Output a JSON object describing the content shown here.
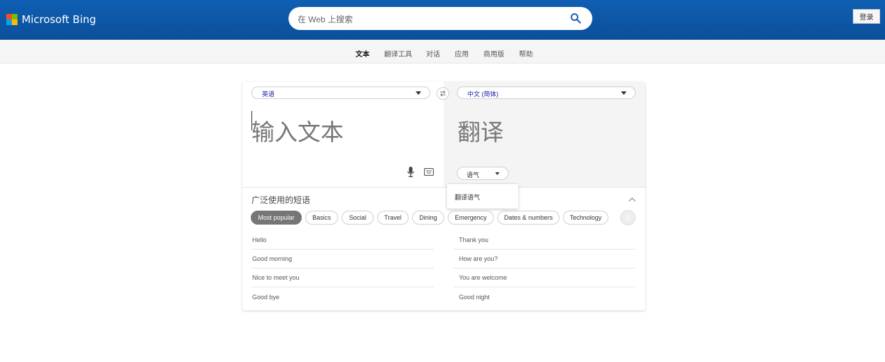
{
  "header": {
    "brand": "Microsoft Bing",
    "logo_colors": [
      "#f25022",
      "#7fba00",
      "#00a4ef",
      "#ffb900"
    ],
    "search_placeholder": "在 Web 上搜索",
    "login_label": "登录"
  },
  "nav": {
    "items": [
      "文本",
      "翻译工具",
      "对话",
      "应用",
      "商用版",
      "帮助"
    ],
    "active": "文本"
  },
  "translator": {
    "source_lang": "英语",
    "target_lang": "中文 (简体)",
    "source_placeholder": "输入文本",
    "target_placeholder": "翻译",
    "tone_label": "语气",
    "tone_dropdown_option": "翻译语气"
  },
  "phrases": {
    "title": "广泛使用的短语",
    "categories": [
      "Most popular",
      "Basics",
      "Social",
      "Travel",
      "Dining",
      "Emergency",
      "Dates & numbers",
      "Technology"
    ],
    "active_category": "Most popular",
    "left_column": [
      "Hello",
      "Good morning",
      "Nice to meet you",
      "Good bye"
    ],
    "right_column": [
      "Thank you",
      "How are you?",
      "You are welcome",
      "Good night"
    ]
  }
}
